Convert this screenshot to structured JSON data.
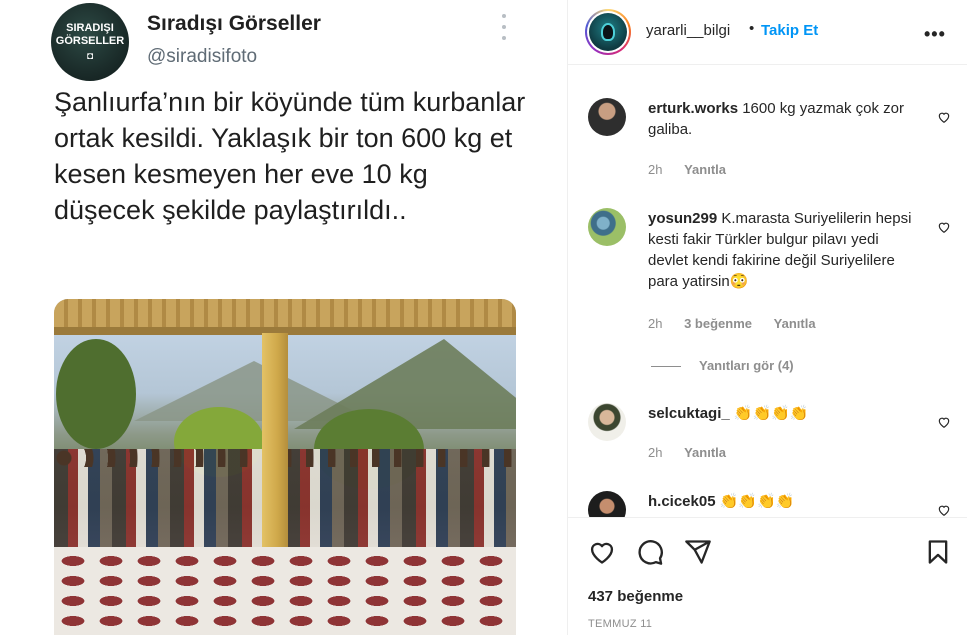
{
  "tweet": {
    "avatar_text_line1": "SIRADIŞI",
    "avatar_text_line2": "GÖRSELLER",
    "name": "Sıradışı Görseller",
    "handle": "@siradisifoto",
    "text": "Şanlıurfa’nın bir köyünde tüm kurbanlar ortak kesildi. Yaklaşık bir ton 600 kg et kesen kesmeyen her eve 10 kg düşecek şekilde paylaştırıldı.."
  },
  "header": {
    "username": "yararli__bilgi",
    "dot": "•",
    "follow_label": "Takip Et",
    "options_label": "•••"
  },
  "comments": [
    {
      "user": "erturk.works",
      "text": "1600 kg yazmak çok zor galiba.",
      "time": "2h",
      "likes": "",
      "reply": "Yanıtla"
    },
    {
      "user": "yosun299",
      "text": "K.marasta Suriyelilerin hepsi kesti fakir Türkler bulgur pilavı yedi devlet kendi fakirine değil Suriyelilere para yatirsin",
      "emoji": "😳",
      "time": "2h",
      "likes": "3 beğenme",
      "reply": "Yanıtla",
      "view_replies": "Yanıtları gör (4)"
    },
    {
      "user": "selcuktagi_",
      "text": "👏👏👏👏",
      "time": "2h",
      "likes": "",
      "reply": "Yanıtla"
    },
    {
      "user": "h.cicek05",
      "text": "👏👏👏👏",
      "time": "",
      "likes": "",
      "reply": ""
    }
  ],
  "footer": {
    "likes": "437 beğenme",
    "date": "TEMMUZ 11"
  },
  "colors": {
    "accent": "#0095f6",
    "text": "#262626",
    "muted": "#8e8e8e",
    "border": "#efefef"
  }
}
